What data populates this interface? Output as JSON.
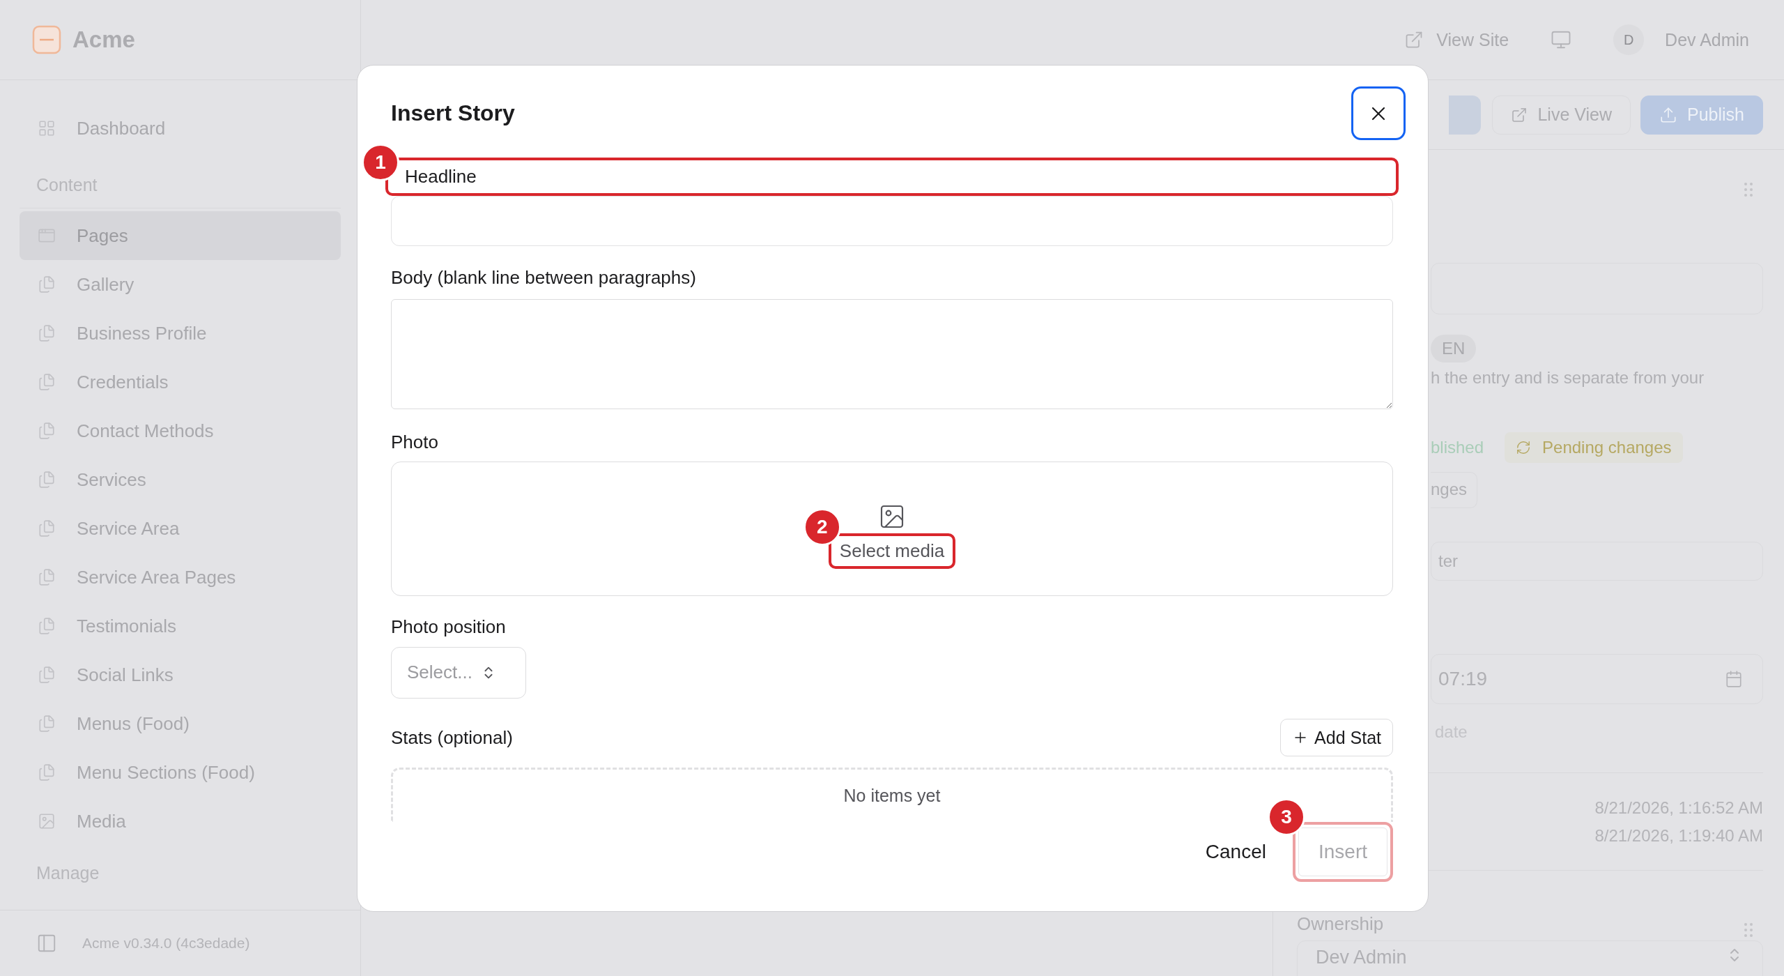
{
  "app": {
    "name": "Acme"
  },
  "top_bar": {
    "view_site": "View Site",
    "avatar_initial": "D",
    "user_name": "Dev Admin"
  },
  "sidebar": {
    "top_items": [
      {
        "label": "Dashboard",
        "kind": "grid",
        "selected": false
      }
    ],
    "content_heading": "Content",
    "content_items": [
      {
        "label": "Pages",
        "kind": "window",
        "selected": true
      },
      {
        "label": "Gallery",
        "kind": "doc",
        "selected": false
      },
      {
        "label": "Business Profile",
        "kind": "doc",
        "selected": false
      },
      {
        "label": "Credentials",
        "kind": "doc",
        "selected": false
      },
      {
        "label": "Contact Methods",
        "kind": "doc",
        "selected": false
      },
      {
        "label": "Services",
        "kind": "doc",
        "selected": false
      },
      {
        "label": "Service Area",
        "kind": "doc",
        "selected": false
      },
      {
        "label": "Service Area Pages",
        "kind": "doc",
        "selected": false
      },
      {
        "label": "Testimonials",
        "kind": "doc",
        "selected": false
      },
      {
        "label": "Social Links",
        "kind": "doc",
        "selected": false
      },
      {
        "label": "Menus (Food)",
        "kind": "doc",
        "selected": false
      },
      {
        "label": "Menu Sections (Food)",
        "kind": "doc",
        "selected": false
      },
      {
        "label": "Media",
        "kind": "image",
        "selected": false
      }
    ],
    "manage_heading": "Manage",
    "version": "Acme v0.34.0 (4c3edade)"
  },
  "toolbar": {
    "buttons": [
      {
        "label": "Live View",
        "kind": "outline"
      },
      {
        "label": "Publish",
        "kind": "primary"
      }
    ]
  },
  "entry_panel": {
    "language": "EN",
    "note_fragment": "h the entry and is separate from your",
    "status_published": "blished",
    "status_pending": "Pending changes",
    "changes_button": "nges",
    "filter_fragment": "ter",
    "time": "07:19",
    "date_hint": "date",
    "timestamps": [
      "8/21/2026, 1:16:52 AM",
      "8/21/2026, 1:19:40 AM"
    ],
    "ownership_heading": "Ownership",
    "owner": "Dev Admin"
  },
  "dialog": {
    "title": "Insert Story",
    "fields": [
      {
        "kind": "text",
        "label": "Headline",
        "step": "1"
      },
      {
        "kind": "textarea",
        "label": "Body (blank line between paragraphs)"
      },
      {
        "kind": "media",
        "label": "Photo",
        "action": "Select media",
        "step": "2"
      },
      {
        "kind": "select",
        "label": "Photo position",
        "placeholder": "Select..."
      },
      {
        "kind": "list",
        "label": "Stats (optional)",
        "add_button": "Add Stat",
        "empty_text": "No items yet"
      }
    ],
    "cancel": "Cancel",
    "insert": "Insert",
    "insert_disabled": true,
    "insert_step": "3"
  }
}
